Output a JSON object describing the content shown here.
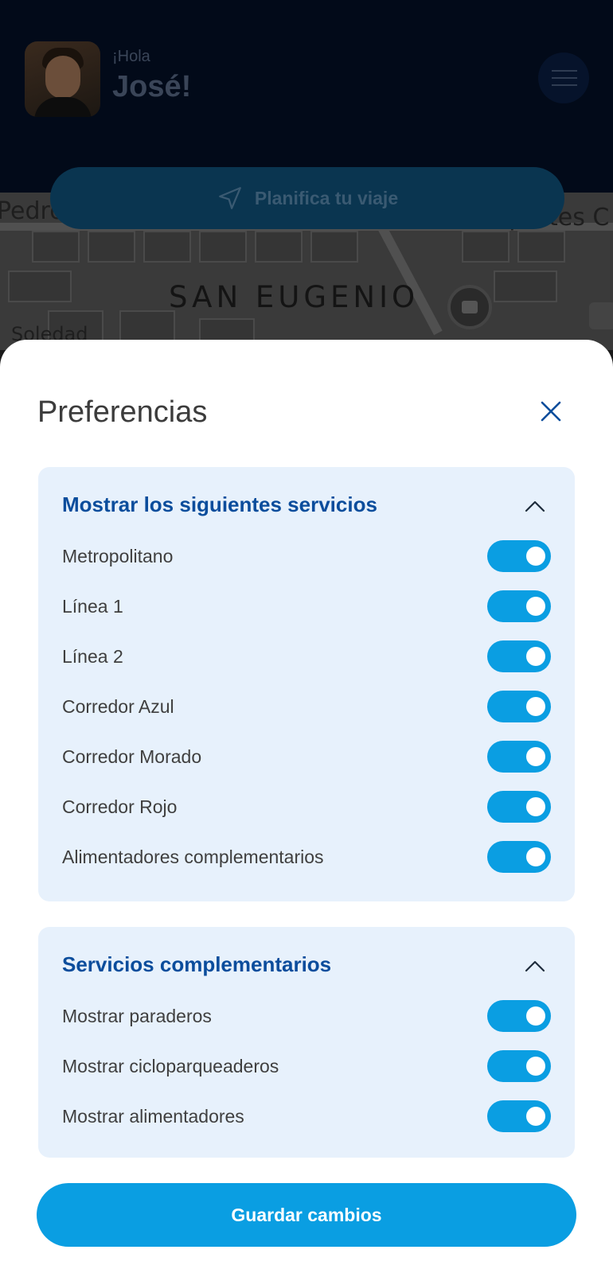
{
  "header": {
    "greeting": "¡Hola",
    "user_name": "José!",
    "avatar_icon": "user-avatar",
    "menu_icon": "hamburger-menu-icon",
    "plan_trip_label": "Planifica tu viaje",
    "plan_trip_icon": "navigation-arrow-icon"
  },
  "map": {
    "district_label": "SAN EUGENIO",
    "partial_labels": [
      "Pedro",
      "Soledad",
      "Transportes C"
    ]
  },
  "sheet": {
    "title": "Preferencias",
    "close_icon": "close-icon",
    "sections": [
      {
        "title": "Mostrar los siguientes servicios",
        "expanded": true,
        "items": [
          {
            "label": "Metropolitano",
            "enabled": true
          },
          {
            "label": "Línea 1",
            "enabled": true
          },
          {
            "label": "Línea 2",
            "enabled": true
          },
          {
            "label": "Corredor Azul",
            "enabled": true
          },
          {
            "label": "Corredor Morado",
            "enabled": true
          },
          {
            "label": "Corredor Rojo",
            "enabled": true
          },
          {
            "label": "Alimentadores complementarios",
            "enabled": true
          }
        ]
      },
      {
        "title": "Servicios complementarios",
        "expanded": true,
        "items": [
          {
            "label": "Mostrar paraderos",
            "enabled": true
          },
          {
            "label": "Mostrar cicloparqueaderos",
            "enabled": true
          },
          {
            "label": "Mostrar alimentadores",
            "enabled": true
          }
        ]
      }
    ],
    "save_label": "Guardar cambios"
  },
  "colors": {
    "accent": "#0a9ee2",
    "section_title": "#0b4d9c",
    "card_background": "#e7f1fc",
    "overlay_header": "#020a19"
  }
}
